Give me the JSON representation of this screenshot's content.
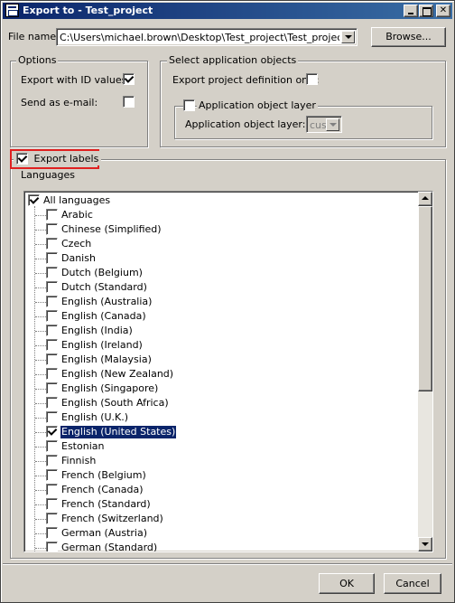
{
  "window": {
    "title": "Export to - Test_project"
  },
  "file": {
    "label": "File name:",
    "value": "C:\\Users\\michael.brown\\Desktop\\Test_project\\Test_project - DE",
    "browse_label": "Browse..."
  },
  "options": {
    "title": "Options",
    "export_id_values": {
      "label": "Export with ID values:",
      "checked": true
    },
    "send_email": {
      "label": "Send as e-mail:",
      "checked": false
    }
  },
  "app_objects": {
    "title": "Select application objects",
    "export_project_def": {
      "label": "Export project definition only:",
      "checked": false
    },
    "layer_group": {
      "label": "Application object layer",
      "checked": false
    },
    "layer_field": {
      "label": "Application object layer:",
      "value": "cus"
    }
  },
  "export_labels": {
    "label": "Export labels",
    "checked": true
  },
  "languages": {
    "title": "Languages",
    "root": {
      "label": "All languages",
      "checked": true
    },
    "items": [
      {
        "label": "Arabic",
        "checked": false
      },
      {
        "label": "Chinese (Simplified)",
        "checked": false
      },
      {
        "label": "Czech",
        "checked": false
      },
      {
        "label": "Danish",
        "checked": false
      },
      {
        "label": "Dutch (Belgium)",
        "checked": false
      },
      {
        "label": "Dutch (Standard)",
        "checked": false
      },
      {
        "label": "English (Australia)",
        "checked": false
      },
      {
        "label": "English (Canada)",
        "checked": false
      },
      {
        "label": "English (India)",
        "checked": false
      },
      {
        "label": "English (Ireland)",
        "checked": false
      },
      {
        "label": "English (Malaysia)",
        "checked": false
      },
      {
        "label": "English (New Zealand)",
        "checked": false
      },
      {
        "label": "English (Singapore)",
        "checked": false
      },
      {
        "label": "English (South Africa)",
        "checked": false
      },
      {
        "label": "English (U.K.)",
        "checked": false
      },
      {
        "label": "English (United States)",
        "checked": true,
        "selected": true
      },
      {
        "label": "Estonian",
        "checked": false
      },
      {
        "label": "Finnish",
        "checked": false
      },
      {
        "label": "French (Belgium)",
        "checked": false
      },
      {
        "label": "French (Canada)",
        "checked": false
      },
      {
        "label": "French (Standard)",
        "checked": false
      },
      {
        "label": "French (Switzerland)",
        "checked": false
      },
      {
        "label": "German (Austria)",
        "checked": false
      },
      {
        "label": "German (Standard)",
        "checked": false
      }
    ]
  },
  "buttons": {
    "ok_label": "OK",
    "cancel_label": "Cancel"
  }
}
